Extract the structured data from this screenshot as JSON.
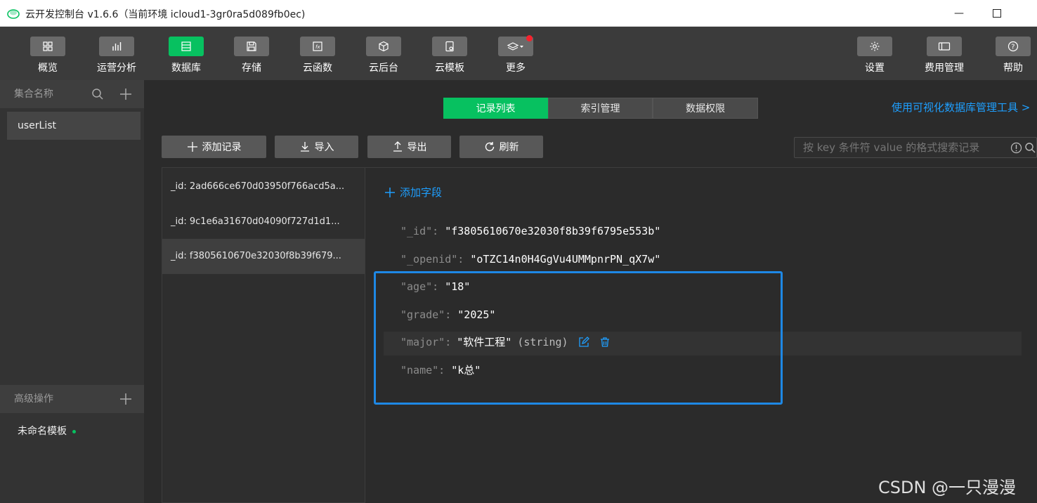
{
  "window": {
    "title": "云开发控制台 v1.6.6（当前环境 icloud1-3gr0ra5d089fb0ec)",
    "minimize_icon": "minimize-icon",
    "maximize_icon": "maximize-icon"
  },
  "toolbar": {
    "items": [
      {
        "label": "概览",
        "icon": "grid-icon"
      },
      {
        "label": "运营分析",
        "icon": "bar-chart-icon"
      },
      {
        "label": "数据库",
        "icon": "database-icon",
        "active": true
      },
      {
        "label": "存储",
        "icon": "save-icon"
      },
      {
        "label": "云函数",
        "icon": "function-icon"
      },
      {
        "label": "云后台",
        "icon": "cube-icon"
      },
      {
        "label": "云模板",
        "icon": "template-icon"
      },
      {
        "label": "更多",
        "icon": "layers-icon"
      }
    ],
    "right_items": [
      {
        "label": "设置",
        "icon": "gear-icon"
      },
      {
        "label": "费用管理",
        "icon": "billing-icon"
      },
      {
        "label": "帮助",
        "icon": "help-icon"
      }
    ]
  },
  "sidebar": {
    "collections_header": "集合名称",
    "collections": [
      "userList"
    ],
    "advanced_header": "高级操作",
    "templates": [
      "未命名模板"
    ]
  },
  "tabs": [
    "记录列表",
    "索引管理",
    "数据权限"
  ],
  "visual_link": "使用可视化数据库管理工具 >",
  "actions": {
    "add_record": "添加记录",
    "import": "导入",
    "export": "导出",
    "refresh": "刷新"
  },
  "search": {
    "placeholder": "按 key 条件符 value 的格式搜索记录"
  },
  "records": [
    "_id: 2ad666ce670d03950f766acd5a...",
    "_id: 9c1e6a31670d04090f727d1d1...",
    "_id: f3805610670e32030f8b39f679..."
  ],
  "detail": {
    "add_field": "添加字段",
    "fields": [
      {
        "key": "\"_id\":",
        "value": "\"f3805610670e32030f8b39f6795e553b\""
      },
      {
        "key": "\"_openid\":",
        "value": "\"oTZC14n0H4GgVu4UMMpnrPN_qX7w\""
      },
      {
        "key": "\"age\":",
        "value": "\"18\""
      },
      {
        "key": "\"grade\":",
        "value": "\"2025\""
      },
      {
        "key": "\"major\":",
        "value": "\"软件工程\"",
        "type": "(string)"
      },
      {
        "key": "\"name\":",
        "value": "\"k总\""
      }
    ]
  },
  "watermark": "CSDN @一只漫漫",
  "colors": {
    "accent": "#07c160",
    "highlight": "#1e88e5",
    "link": "#1e9fff"
  }
}
